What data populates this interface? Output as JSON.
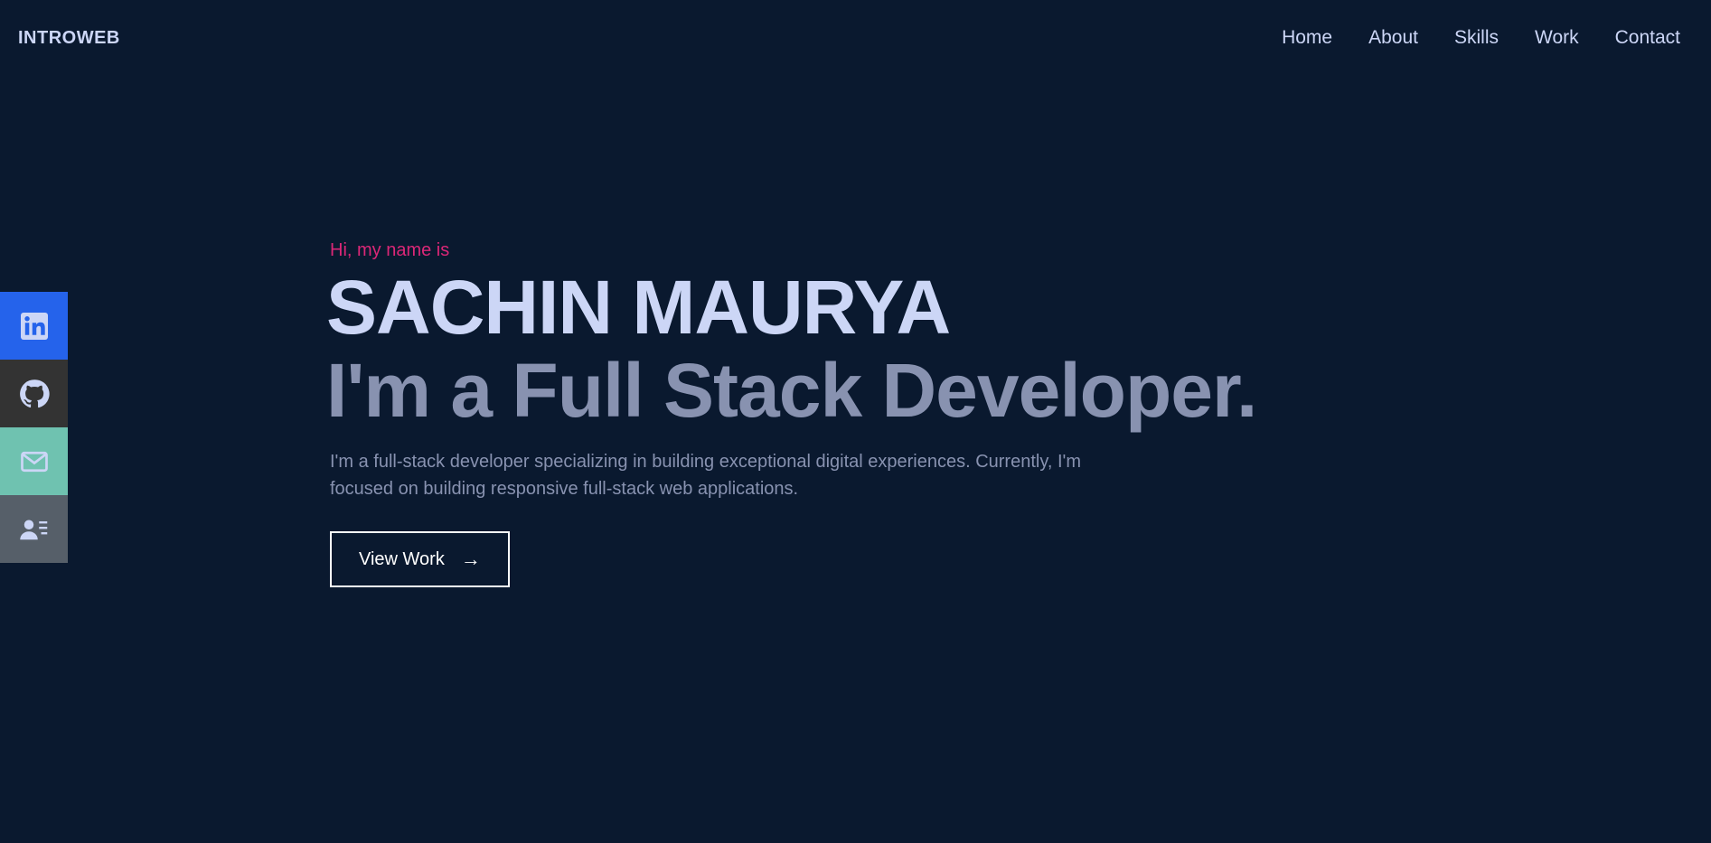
{
  "header": {
    "logo": "INTROWEB",
    "nav": [
      "Home",
      "About",
      "Skills",
      "Work",
      "Contact"
    ]
  },
  "social": [
    {
      "name": "linkedin",
      "icon": "linkedin-icon",
      "color": "#2563eb"
    },
    {
      "name": "github",
      "icon": "github-icon",
      "color": "#333333"
    },
    {
      "name": "email",
      "icon": "mail-icon",
      "color": "#6fc2b0"
    },
    {
      "name": "resume",
      "icon": "contact-card-icon",
      "color": "#565f69"
    }
  ],
  "hero": {
    "greeting": "Hi, my name is",
    "name": "SACHIN MAURYA",
    "tagline": "I'm a Full Stack Developer.",
    "description": "I'm a full-stack developer specializing in building exceptional digital experiences. Currently, I'm focused on building responsive full-stack web applications.",
    "cta_label": "View Work",
    "cta_icon": "arrow-right-icon"
  },
  "colors": {
    "background": "#0a192f",
    "primary_text": "#ccd6f6",
    "secondary_text": "#8892b0",
    "accent": "#db2777"
  }
}
